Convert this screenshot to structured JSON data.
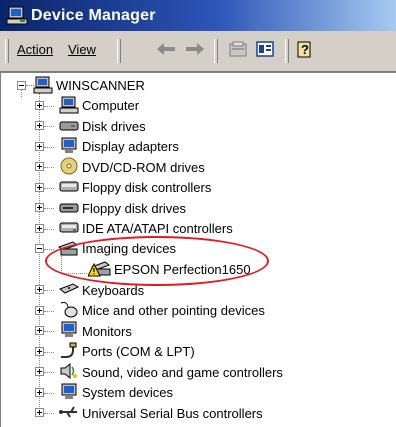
{
  "window": {
    "title": "Device Manager",
    "title_icon": "device-manager-icon"
  },
  "menu": {
    "action_label": "Action",
    "view_label": "View"
  },
  "toolbar": {
    "buttons": [
      "back-arrow-icon",
      "forward-arrow-icon",
      "properties-icon",
      "show-hidden-icon",
      "help-icon"
    ]
  },
  "tree": {
    "root_label": "WINSCANNER",
    "items": [
      {
        "label": "Computer",
        "icon": "computer-icon"
      },
      {
        "label": "Disk drives",
        "icon": "disk-drive-icon"
      },
      {
        "label": "Display adapters",
        "icon": "display-adapter-icon"
      },
      {
        "label": "DVD/CD-ROM drives",
        "icon": "dvd-cdrom-icon"
      },
      {
        "label": "Floppy disk controllers",
        "icon": "floppy-controller-icon"
      },
      {
        "label": "Floppy disk drives",
        "icon": "floppy-drive-icon"
      },
      {
        "label": "IDE ATA/ATAPI controllers",
        "icon": "ide-controller-icon"
      },
      {
        "label": "Imaging devices",
        "icon": "imaging-device-icon"
      },
      {
        "label": "EPSON Perfection1650",
        "icon": "scanner-warning-icon"
      },
      {
        "label": "Keyboards",
        "icon": "keyboard-icon"
      },
      {
        "label": "Mice and other pointing devices",
        "icon": "mouse-icon"
      },
      {
        "label": "Monitors",
        "icon": "monitor-icon"
      },
      {
        "label": "Ports (COM & LPT)",
        "icon": "port-icon"
      },
      {
        "label": "Sound, video and game controllers",
        "icon": "sound-icon"
      },
      {
        "label": "System devices",
        "icon": "system-device-icon"
      },
      {
        "label": "Universal Serial Bus controllers",
        "icon": "usb-icon"
      }
    ]
  },
  "colors": {
    "title_gradient_start": "#0a246a",
    "title_gradient_end": "#a6caf0",
    "highlight": "#e01b24"
  }
}
